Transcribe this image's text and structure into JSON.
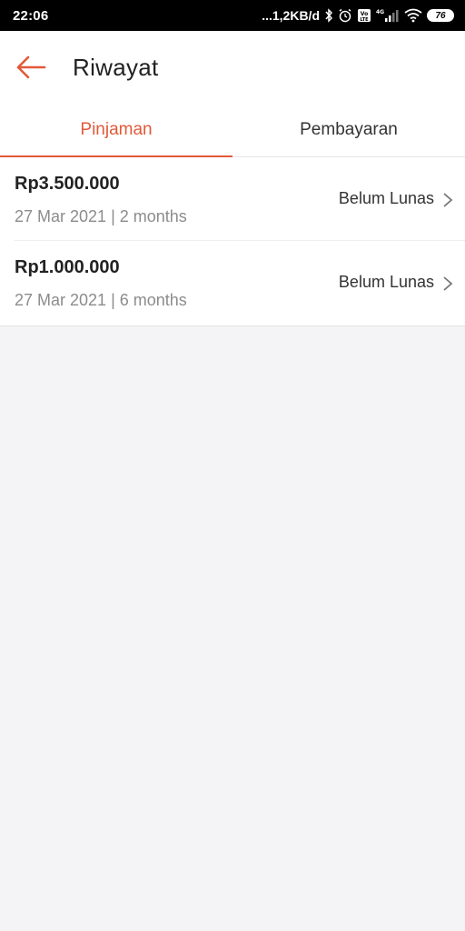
{
  "status_bar": {
    "time": "22:06",
    "network_speed": "...1,2KB/d",
    "network_type": "4G",
    "battery": "76"
  },
  "header": {
    "title": "Riwayat",
    "back_icon": "arrow-left-icon"
  },
  "tabs": [
    {
      "label": "Pinjaman",
      "active": true
    },
    {
      "label": "Pembayaran",
      "active": false
    }
  ],
  "loans": [
    {
      "amount": "Rp3.500.000",
      "meta": "27 Mar 2021 | 2 months",
      "status": "Belum Lunas"
    },
    {
      "amount": "Rp1.000.000",
      "meta": "27 Mar 2021 | 6 months",
      "status": "Belum Lunas"
    }
  ],
  "colors": {
    "accent": "#e2593a",
    "background": "#f4f4f6"
  }
}
